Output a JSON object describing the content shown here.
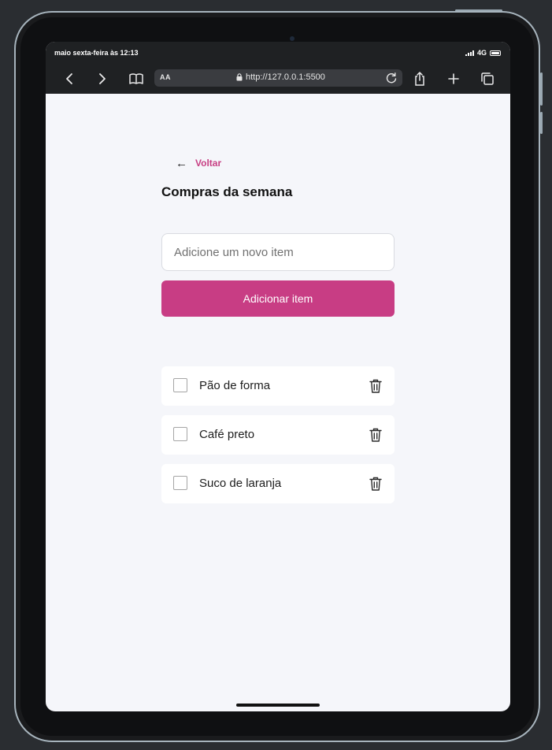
{
  "status_bar": {
    "time": "maio sexta-feira às 12:13",
    "network": "4G"
  },
  "browser": {
    "aa_label": "AA",
    "url": "http://127.0.0.1:5500"
  },
  "page": {
    "back_label": "Voltar",
    "back_arrow": "←",
    "title": "Compras da semana",
    "input_placeholder": "Adicione um novo item",
    "add_button_label": "Adicionar item",
    "items": [
      {
        "label": "Pão de forma",
        "checked": false
      },
      {
        "label": "Café preto",
        "checked": false
      },
      {
        "label": "Suco de laranja",
        "checked": false
      }
    ]
  },
  "colors": {
    "accent": "#c83d84",
    "page_background": "#f5f6fa",
    "browser_bar": "#1f2123"
  },
  "icons": {
    "nav_back": "chevron-left-icon",
    "nav_forward": "chevron-right-icon",
    "bookmarks": "book-icon",
    "lock": "lock-icon",
    "reload": "reload-icon",
    "share": "share-icon",
    "new_tab": "plus-icon",
    "tabs": "tabs-icon",
    "delete": "trash-icon"
  }
}
